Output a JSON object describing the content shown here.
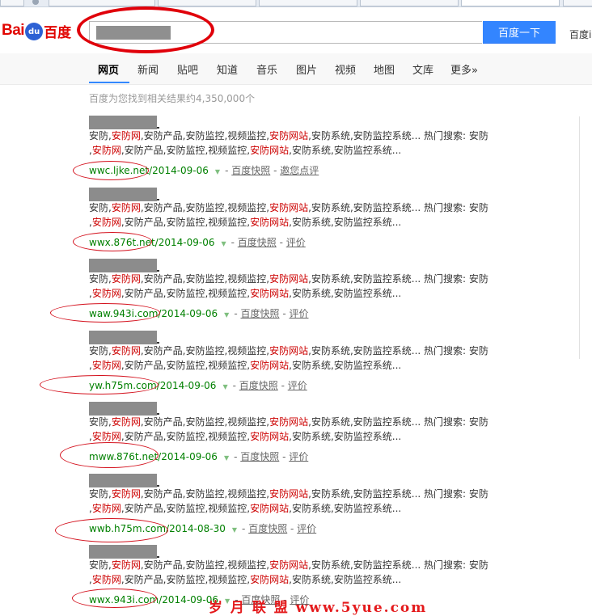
{
  "header": {
    "logo_left": "Bai",
    "logo_paw": "du",
    "logo_right": "百度",
    "search_button": "百度一下",
    "side_link": "百度i"
  },
  "nav": {
    "tabs": [
      "网页",
      "新闻",
      "贴吧",
      "知道",
      "音乐",
      "图片",
      "视频",
      "地图",
      "文库",
      "更多»"
    ],
    "active": "网页"
  },
  "result_count": "百度为您找到相关结果约4,350,000个",
  "results": [
    {
      "line1": [
        "安防,",
        "安防网",
        ",安防产品,安防监控,视频监控,",
        "安防网站",
        ",安防系统,安防监控系统... 热门搜索: 安防"
      ],
      "line2": [
        ",",
        "安防网",
        ",安防产品,安防监控,视频监控,",
        "安防网站",
        ",安防系统,安防监控系统..."
      ],
      "url": "wwc.ljke.net/",
      "date": "2014-09-06",
      "snapshot": "百度快照",
      "review": "邀您点评"
    },
    {
      "line1": [
        "安防,",
        "安防网",
        ",安防产品,安防监控,视频监控,",
        "安防网站",
        ",安防系统,安防监控系统... 热门搜索: 安防"
      ],
      "line2": [
        ",",
        "安防网",
        ",安防产品,安防监控,视频监控,",
        "安防网站",
        ",安防系统,安防监控系统..."
      ],
      "url": "wwx.876t.net/",
      "date": "2014-09-06",
      "snapshot": "百度快照",
      "review": "评价"
    },
    {
      "line1": [
        "安防,",
        "安防网",
        ",安防产品,安防监控,视频监控,",
        "安防网站",
        ",安防系统,安防监控系统... 热门搜索: 安防"
      ],
      "line2": [
        ",",
        "安防网",
        ",安防产品,安防监控,视频监控,",
        "安防网站",
        ",安防系统,安防监控系统..."
      ],
      "url": "waw.943i.com/",
      "date": "2014-09-06",
      "snapshot": "百度快照",
      "review": "评价"
    },
    {
      "line1": [
        "安防,",
        "安防网",
        ",安防产品,安防监控,视频监控,",
        "安防网站",
        ",安防系统,安防监控系统... 热门搜索: 安防"
      ],
      "line2": [
        ",",
        "安防网",
        ",安防产品,安防监控,视频监控,",
        "安防网站",
        ",安防系统,安防监控系统..."
      ],
      "url": "yw.h75m.com/",
      "date": "2014-09-06",
      "snapshot": "百度快照",
      "review": "评价"
    },
    {
      "line1": [
        "安防,",
        "安防网",
        ",安防产品,安防监控,视频监控,",
        "安防网站",
        ",安防系统,安防监控系统... 热门搜索: 安防"
      ],
      "line2": [
        ",",
        "安防网",
        ",安防产品,安防监控,视频监控,",
        "安防网站",
        ",安防系统,安防监控系统..."
      ],
      "url": "mww.876t.net/",
      "date": "2014-09-06",
      "snapshot": "百度快照",
      "review": "评价"
    },
    {
      "line1": [
        "安防,",
        "安防网",
        ",安防产品,安防监控,视频监控,",
        "安防网站",
        ",安防系统,安防监控系统... 热门搜索: 安防"
      ],
      "line2": [
        ",",
        "安防网",
        ",安防产品,安防监控,视频监控,",
        "安防网站",
        ",安防系统,安防监控系统..."
      ],
      "url": "wwb.h75m.com/",
      "date": "2014-08-30",
      "snapshot": "百度快照",
      "review": "评价"
    },
    {
      "line1": [
        "安防,",
        "安防网",
        ",安防产品,安防监控,视频监控,",
        "安防网站",
        ",安防系统,安防监控系统... 热门搜索: 安防"
      ],
      "line2": [
        ",",
        "安防网",
        ",安防产品,安防监控,视频监控,",
        "安防网站",
        ",安防系统,安防监控系统..."
      ],
      "url": "wwx.943i.com/",
      "date": "2014-09-06",
      "snapshot": "百度快照",
      "review": "评价"
    }
  ],
  "watermark": "岁 月 联 盟 www.5yue.com",
  "colors": {
    "brand_red": "#e10602",
    "button_blue": "#3385ff",
    "url_green": "#008000",
    "highlight_red": "#cc0000",
    "annotation_red": "#d4121e"
  }
}
